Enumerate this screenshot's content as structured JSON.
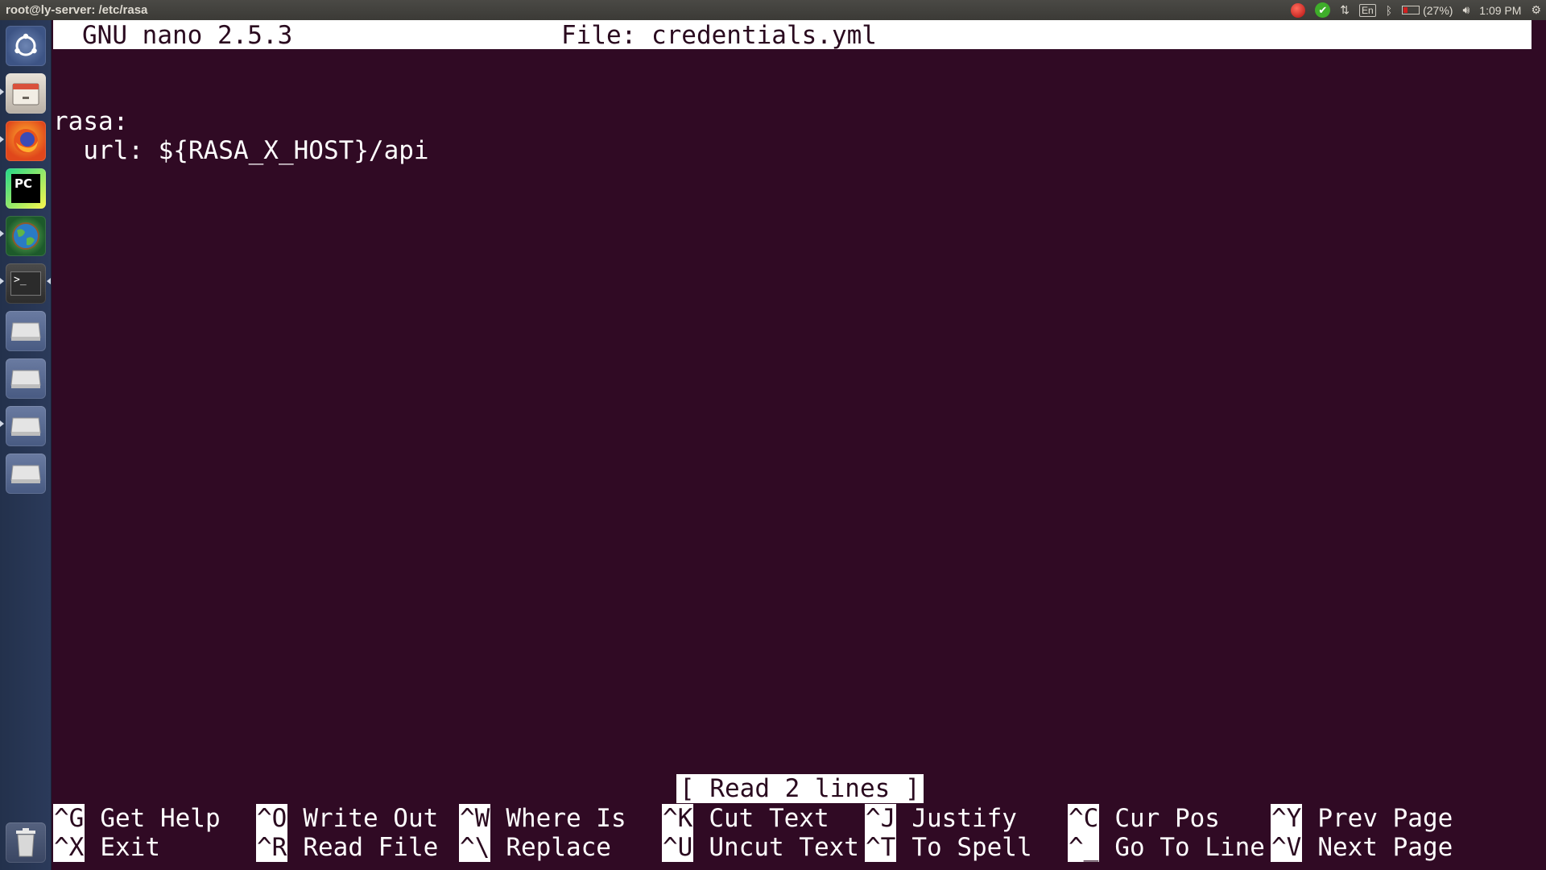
{
  "topbar": {
    "window_title": "root@ly-server: /etc/rasa",
    "indicators": {
      "record_icon": "record-icon",
      "update_icon": "check-icon",
      "network_icon": "network-arrows-icon",
      "keyboard_layout": "En",
      "bluetooth_icon": "bluetooth-icon",
      "battery_percent": "(27%)",
      "battery_level": 0.27,
      "volume_icon": "volume-icon",
      "clock": "1:09 PM",
      "settings_icon": "gear-icon"
    }
  },
  "launcher": {
    "items": [
      {
        "name": "ubuntu-dash-icon"
      },
      {
        "name": "file-manager-icon"
      },
      {
        "name": "firefox-icon"
      },
      {
        "name": "pycharm-icon",
        "label": "PC"
      },
      {
        "name": "browser-globe-icon"
      },
      {
        "name": "terminal-icon",
        "label": ">_"
      },
      {
        "name": "drive-icon"
      },
      {
        "name": "drive-icon"
      },
      {
        "name": "drive-icon"
      },
      {
        "name": "drive-icon"
      },
      {
        "name": "trash-icon"
      }
    ]
  },
  "nano": {
    "version": "GNU nano 2.5.3",
    "file_label": "File: credentials.yml",
    "buffer": [
      "",
      "rasa:",
      "  url: ${RASA_X_HOST}/api"
    ],
    "status_message": "[ Read 2 lines ]",
    "shortcuts_row1": [
      {
        "key": "^G",
        "label": "Get Help"
      },
      {
        "key": "^O",
        "label": "Write Out"
      },
      {
        "key": "^W",
        "label": "Where Is"
      },
      {
        "key": "^K",
        "label": "Cut Text"
      },
      {
        "key": "^J",
        "label": "Justify"
      },
      {
        "key": "^C",
        "label": "Cur Pos"
      },
      {
        "key": "^Y",
        "label": "Prev Page"
      }
    ],
    "shortcuts_row2": [
      {
        "key": "^X",
        "label": "Exit"
      },
      {
        "key": "^R",
        "label": "Read File"
      },
      {
        "key": "^\\",
        "label": "Replace"
      },
      {
        "key": "^U",
        "label": "Uncut Text"
      },
      {
        "key": "^T",
        "label": "To Spell"
      },
      {
        "key": "^_",
        "label": "Go To Line"
      },
      {
        "key": "^V",
        "label": "Next Page"
      }
    ]
  },
  "colors": {
    "terminal_bg": "#300a24",
    "terminal_fg": "#ffffff",
    "launcher_bg": "#23314c"
  }
}
